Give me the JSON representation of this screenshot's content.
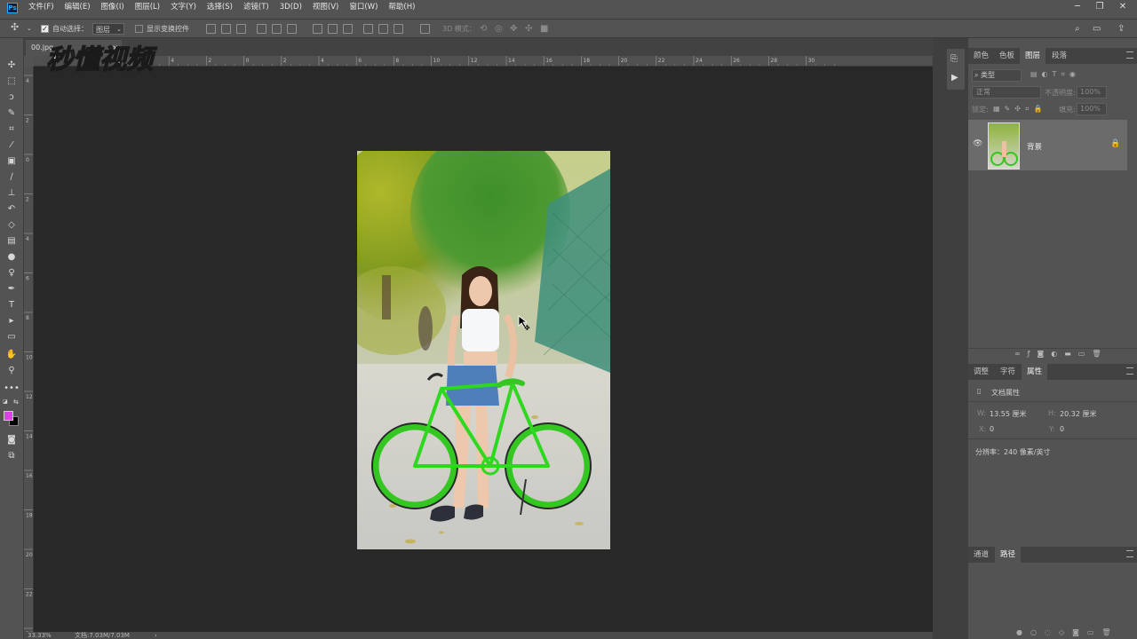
{
  "app": {
    "logo_text": "Ps"
  },
  "menu": [
    "文件(F)",
    "编辑(E)",
    "图像(I)",
    "图层(L)",
    "文字(Y)",
    "选择(S)",
    "滤镜(T)",
    "3D(D)",
    "视图(V)",
    "窗口(W)",
    "帮助(H)"
  ],
  "options": {
    "auto_select_label": "自动选择：",
    "auto_select_value": "图层",
    "show_transform_label": "显示变换控件",
    "mode_3d_label": "3D 模式："
  },
  "document": {
    "tab_label": "00.jpg",
    "zoom": "33.33%",
    "doc_size": "文档:7.03M/7.03M"
  },
  "watermark": {
    "text": "秒懂视频"
  },
  "rulers": {
    "h": [
      "6",
      "4",
      "2",
      "0",
      "2",
      "4",
      "6",
      "8",
      "10",
      "12",
      "14",
      "16",
      "18",
      "20",
      "22",
      "24",
      "26",
      "28",
      "30"
    ],
    "v": [
      "4",
      "2",
      "0",
      "2",
      "4",
      "6",
      "8",
      "10",
      "12",
      "14",
      "16",
      "18",
      "20",
      "22",
      "24"
    ]
  },
  "layers_panel": {
    "tabs": [
      "颜色",
      "色板",
      "图层",
      "段落"
    ],
    "active_tab": "图层",
    "filter_placeholder": "类型",
    "blend_mode": "正常",
    "opacity_label": "不透明度:",
    "opacity_value": "100%",
    "lock_label": "锁定:",
    "fill_label": "填充:",
    "fill_value": "100%",
    "layers": [
      {
        "name": "背景",
        "visible": true,
        "locked": true
      }
    ]
  },
  "properties_panel": {
    "tabs": [
      "调整",
      "字符",
      "属性"
    ],
    "active_tab": "属性",
    "header": "文档属性",
    "w_label": "W:",
    "w_value": "13.55 厘米",
    "h_label": "H:",
    "h_value": "20.32 厘米",
    "x_label": "X:",
    "x_value": "0",
    "y_label": "Y:",
    "y_value": "0",
    "resolution": "分辨率：240 像素/英寸"
  },
  "paths_panel": {
    "tabs": [
      "通道",
      "路径"
    ],
    "active_tab": "路径"
  },
  "colors": {
    "foreground": "#e040e0",
    "background": "#000000",
    "accent": "#31a8ff"
  }
}
